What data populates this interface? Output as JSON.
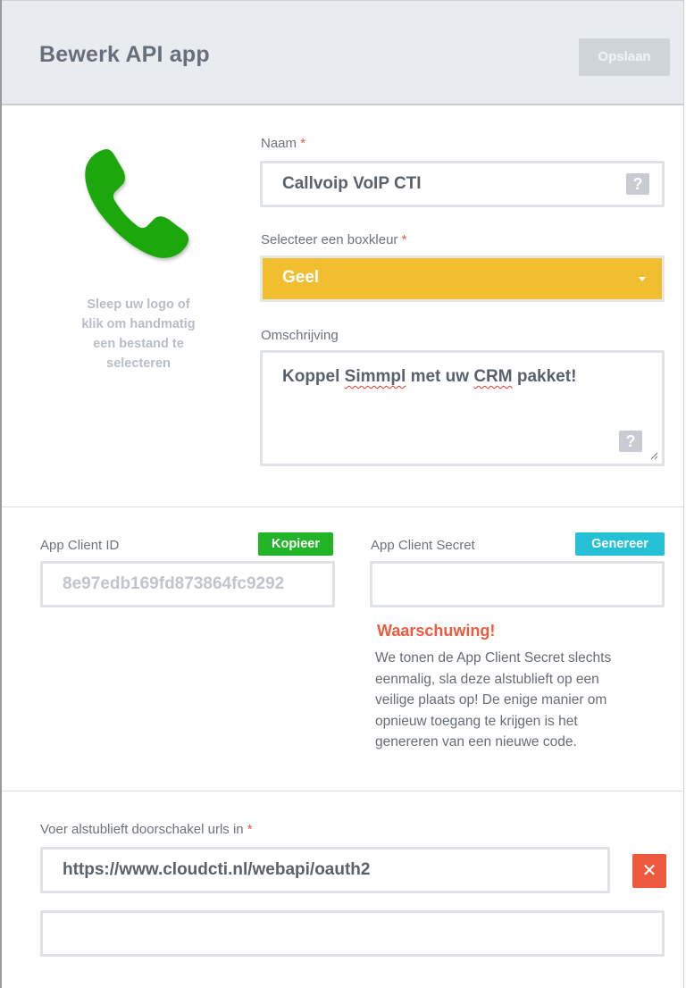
{
  "header": {
    "title": "Bewerk API app",
    "save_label": "Opslaan"
  },
  "logo": {
    "hint_lines": [
      "Sleep uw logo of",
      "klik om handmatig",
      "een bestand te",
      "selecteren"
    ],
    "icon": "phone-icon",
    "icon_color": "#1fa80e"
  },
  "form": {
    "name_label": "Naam",
    "required_mark": "*",
    "name_value": "Callvoip VoIP CTI",
    "help_mark": "?",
    "color_label": "Selecteer een boxkleur",
    "color_value": "Geel",
    "color_hex": "#f0be2f",
    "description_label": "Omschrijving",
    "description_parts": [
      "Koppel ",
      "Simmpl",
      " met uw ",
      "CRM",
      " pakket!"
    ]
  },
  "credentials": {
    "client_id_label": "App Client ID",
    "copy_label": "Kopieer",
    "client_id_value": "8e97edb169fd873864fc9292",
    "client_secret_label": "App Client Secret",
    "generate_label": "Genereer",
    "client_secret_value": "",
    "warning_title": "Waarschuwing!",
    "warning_lines": [
      "We tonen de App Client Secret slechts",
      "eenmalig, sla deze alstublieft op een",
      "veilige plaats op! De enige manier om",
      "opnieuw toegang te krijgen is het",
      "genereren van een nieuwe code."
    ]
  },
  "redirects": {
    "label": "Voer alstublieft doorschakel urls in",
    "urls": [
      "https://www.cloudcti.nl/webapi/oauth2",
      ""
    ],
    "remove_mark": "✕"
  },
  "colors": {
    "kopieer": "#21b427",
    "genereer": "#25bfd6",
    "warning": "#ee5a3f"
  }
}
